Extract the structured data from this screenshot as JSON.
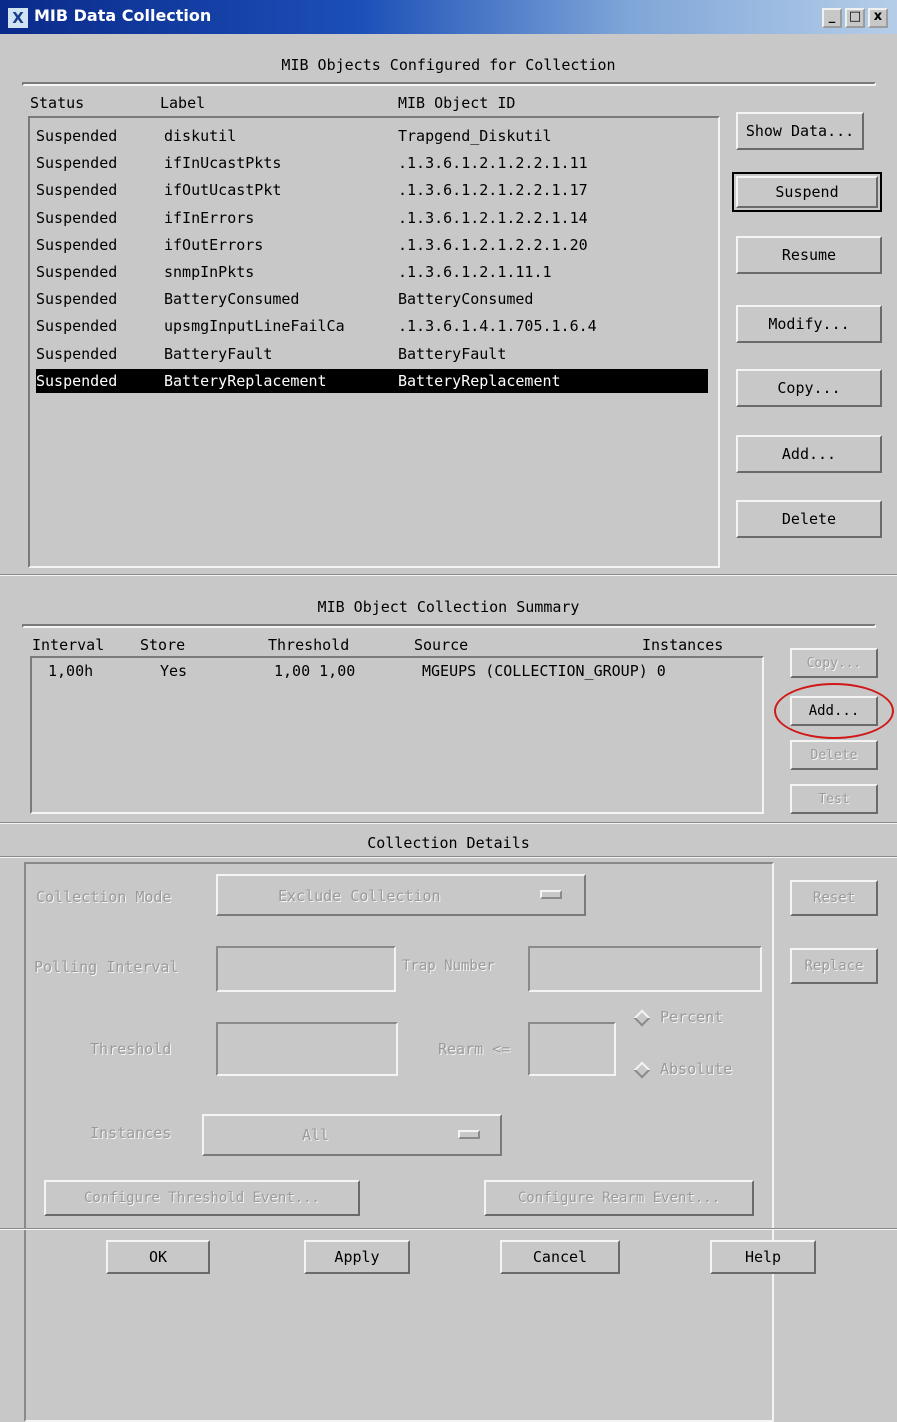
{
  "window": {
    "title": "MIB Data Collection",
    "minimize": "_",
    "maximize": "□",
    "close": "x",
    "logo": "X"
  },
  "configured": {
    "title": "MIB Objects Configured for Collection",
    "columns": [
      "Status",
      "Label",
      "MIB Object ID"
    ],
    "rows": [
      {
        "status": "Suspended",
        "label": "diskutil",
        "oid": "Trapgend_Diskutil"
      },
      {
        "status": "Suspended",
        "label": "ifInUcastPkts",
        "oid": ".1.3.6.1.2.1.2.2.1.11"
      },
      {
        "status": "Suspended",
        "label": "ifOutUcastPkt",
        "oid": ".1.3.6.1.2.1.2.2.1.17"
      },
      {
        "status": "Suspended",
        "label": "ifInErrors",
        "oid": ".1.3.6.1.2.1.2.2.1.14"
      },
      {
        "status": "Suspended",
        "label": "ifOutErrors",
        "oid": ".1.3.6.1.2.1.2.2.1.20"
      },
      {
        "status": "Suspended",
        "label": "snmpInPkts",
        "oid": ".1.3.6.1.2.1.11.1"
      },
      {
        "status": "Suspended",
        "label": "BatteryConsumed",
        "oid": "BatteryConsumed"
      },
      {
        "status": "Suspended",
        "label": "upsmgInputLineFailCa",
        "oid": ".1.3.6.1.4.1.705.1.6.4"
      },
      {
        "status": "Suspended",
        "label": "BatteryFault",
        "oid": "BatteryFault"
      },
      {
        "status": "Suspended",
        "label": "BatteryReplacement",
        "oid": "BatteryReplacement"
      }
    ],
    "buttons": {
      "show_data": "Show Data...",
      "suspend": "Suspend",
      "resume": "Resume",
      "modify": "Modify...",
      "copy": "Copy...",
      "add": "Add...",
      "delete": "Delete"
    }
  },
  "summary": {
    "title": "MIB Object Collection Summary",
    "columns": [
      "Interval",
      "Store",
      "Threshold",
      "Source",
      "Instances"
    ],
    "row": {
      "interval": "1,00h",
      "store": "Yes",
      "threshold": "1,00 1,00",
      "source": "MGEUPS (COLLECTION_GROUP) 0",
      "instances": ""
    },
    "buttons": {
      "copy": "Copy...",
      "add": "Add...",
      "delete": "Delete",
      "test": "Test"
    }
  },
  "details": {
    "title": "Collection Details",
    "collection_mode_label": "Collection Mode",
    "collection_mode_value": "Exclude Collection",
    "polling_interval_label": "Polling Interval",
    "trap_number_label": "Trap Number",
    "threshold_label": "Threshold",
    "rearm_label": "Rearm <=",
    "percent_label": "Percent",
    "absolute_label": "Absolute",
    "instances_label": "Instances",
    "instances_value": "All",
    "configure_threshold_event": "Configure Threshold Event...",
    "configure_rearm_event": "Configure Rearm Event...",
    "reset": "Reset",
    "replace": "Replace"
  },
  "footer": {
    "ok": "OK",
    "apply": "Apply",
    "cancel": "Cancel",
    "help": "Help"
  }
}
